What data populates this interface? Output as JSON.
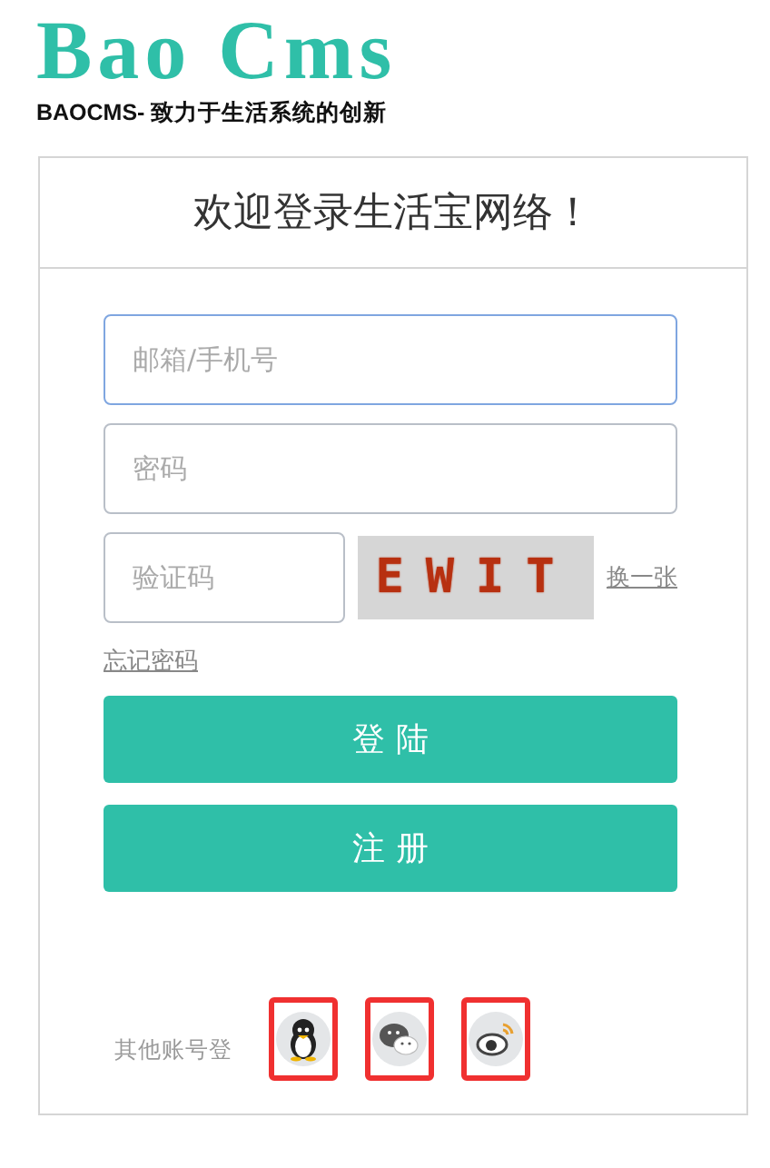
{
  "logo": {
    "title": "Bao Cms",
    "tagline": "BAOCMS- 致力于生活系统的创新"
  },
  "card": {
    "title": "欢迎登录生活宝网络！",
    "fields": [
      {
        "placeholder": "邮箱/手机号",
        "focused": true
      },
      {
        "placeholder": "密码",
        "focused": false
      }
    ],
    "captcha": {
      "placeholder": "验证码",
      "code": "EWIT",
      "refresh": "换一张"
    },
    "forgot": "忘记密码",
    "buttons": [
      "登 陆",
      "注 册"
    ],
    "social": {
      "label": "其他账号登",
      "items": [
        {
          "kind": "qq",
          "highlighted": true
        },
        {
          "kind": "wechat",
          "highlighted": true
        },
        {
          "kind": "weibo",
          "highlighted": true
        }
      ]
    }
  }
}
